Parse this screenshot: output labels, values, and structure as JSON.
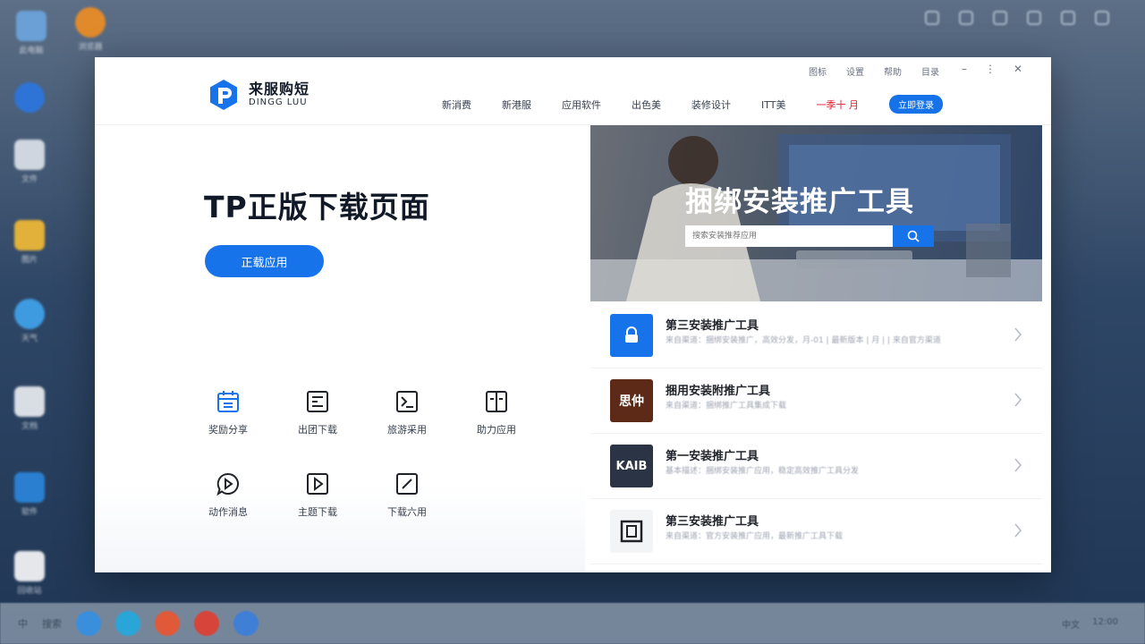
{
  "window": {
    "logo_cn": "来服购短",
    "logo_en": "DINGG LUU",
    "nav": [
      "新消费",
      "新港服",
      "应用软件",
      "出色美",
      "装修设计",
      "ITT美",
      "一季十 月"
    ],
    "nav_button": "立即登录",
    "controls": [
      "图标",
      "设置",
      "帮助",
      "目录"
    ]
  },
  "left": {
    "title": "TP正版下载页面",
    "cta": "正载应用",
    "features": [
      {
        "label": "奖励分享",
        "icon": "calendar-icon"
      },
      {
        "label": "出团下载",
        "icon": "list-doc-icon"
      },
      {
        "label": "旅游采用",
        "icon": "chart-icon"
      },
      {
        "label": "助力应用",
        "icon": "book-icon"
      },
      {
        "label": "动作消息",
        "icon": "chat-play-icon"
      },
      {
        "label": "主题下载",
        "icon": "play-icon"
      },
      {
        "label": "下载六用",
        "icon": "slash-icon"
      }
    ]
  },
  "banner": {
    "title": "捆绑安装推广工具",
    "search_placeholder": "搜索安装推荐应用"
  },
  "list": [
    {
      "title": "第三安装推广工具",
      "logo": "",
      "logo_color": "#1673ea",
      "desc": "来自渠道：捆绑安装推广，高效分发，月-01 | 最新版本 | 月 | | 来自官方渠道"
    },
    {
      "title": "捆用安装附推广工具",
      "logo": "思仲",
      "logo_color": "#5c2a16",
      "desc": "来自渠道：捆绑推广工具集成下载"
    },
    {
      "title": "第一安装推广工具",
      "logo": "KAIB",
      "logo_color": "#2a3445",
      "desc": "基本描述：捆绑安装推广应用，稳定高效推广工具分发"
    },
    {
      "title": "第三安装推广工具",
      "logo": "",
      "logo_color": "#f3f4f6",
      "desc": "来自渠道：官方安装推广应用，最新推广工具下载"
    }
  ],
  "taskbar": {
    "left_text": "中",
    "search": "搜索",
    "right": [
      "中文",
      "12:00"
    ]
  },
  "desktop": [
    "此电脑",
    "浏览器",
    "文件",
    "图片",
    "天气",
    "文档",
    "软件",
    "回收站"
  ],
  "colors": {
    "accent": "#1673ea",
    "promo": "#e11d2e"
  }
}
